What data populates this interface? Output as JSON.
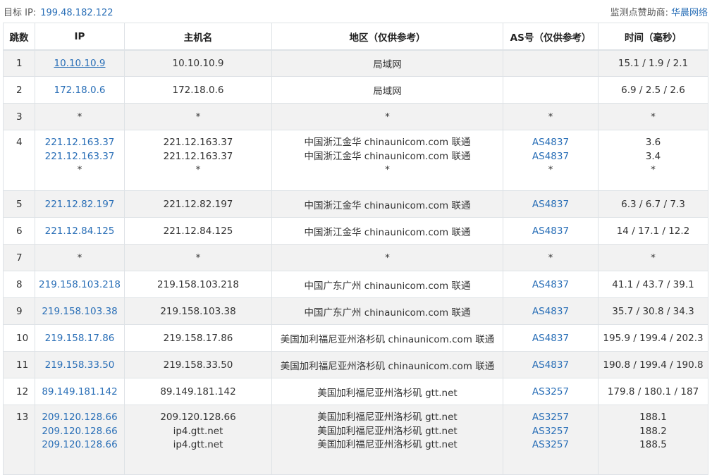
{
  "header": {
    "target_label": "目标 IP:",
    "target_ip": "199.48.182.122",
    "sponsor_label": "监测点赞助商:",
    "sponsor_name": "华晨网络"
  },
  "table": {
    "columns": [
      "跳数",
      "IP",
      "主机名",
      "地区（仅供参考）",
      "AS号（仅供参考）",
      "时间（毫秒）"
    ],
    "rows": [
      {
        "hop": "1",
        "ips": [
          "10.10.10.9"
        ],
        "hosts": [
          "10.10.10.9"
        ],
        "regions": [
          "局域网"
        ],
        "as": [
          ""
        ],
        "times": [
          "15.1 / 1.9 / 2.1"
        ]
      },
      {
        "hop": "2",
        "ips": [
          "172.18.0.6"
        ],
        "hosts": [
          "172.18.0.6"
        ],
        "regions": [
          "局域网"
        ],
        "as": [
          ""
        ],
        "times": [
          "6.9 / 2.5 / 2.6"
        ]
      },
      {
        "hop": "3",
        "ips": [
          "*"
        ],
        "hosts": [
          "*"
        ],
        "regions": [
          "*"
        ],
        "as": [
          "*"
        ],
        "times": [
          "*"
        ]
      },
      {
        "hop": "4",
        "ips": [
          "221.12.163.37",
          "221.12.163.37",
          "*"
        ],
        "hosts": [
          "221.12.163.37",
          "221.12.163.37",
          "*"
        ],
        "regions": [
          "中国浙江金华 chinaunicom.com 联通",
          "中国浙江金华 chinaunicom.com 联通",
          "*"
        ],
        "as": [
          "AS4837",
          "AS4837",
          "*"
        ],
        "times": [
          "3.6",
          "3.4",
          "*"
        ]
      },
      {
        "hop": "5",
        "ips": [
          "221.12.82.197"
        ],
        "hosts": [
          "221.12.82.197"
        ],
        "regions": [
          "中国浙江金华 chinaunicom.com 联通"
        ],
        "as": [
          "AS4837"
        ],
        "times": [
          "6.3 / 6.7 / 7.3"
        ]
      },
      {
        "hop": "6",
        "ips": [
          "221.12.84.125"
        ],
        "hosts": [
          "221.12.84.125"
        ],
        "regions": [
          "中国浙江金华 chinaunicom.com 联通"
        ],
        "as": [
          "AS4837"
        ],
        "times": [
          "14 / 17.1 / 12.2"
        ]
      },
      {
        "hop": "7",
        "ips": [
          "*"
        ],
        "hosts": [
          "*"
        ],
        "regions": [
          "*"
        ],
        "as": [
          "*"
        ],
        "times": [
          "*"
        ]
      },
      {
        "hop": "8",
        "ips": [
          "219.158.103.218"
        ],
        "hosts": [
          "219.158.103.218"
        ],
        "regions": [
          "中国广东广州 chinaunicom.com 联通"
        ],
        "as": [
          "AS4837"
        ],
        "times": [
          "41.1 / 43.7 / 39.1"
        ]
      },
      {
        "hop": "9",
        "ips": [
          "219.158.103.38"
        ],
        "hosts": [
          "219.158.103.38"
        ],
        "regions": [
          "中国广东广州 chinaunicom.com 联通"
        ],
        "as": [
          "AS4837"
        ],
        "times": [
          "35.7 / 30.8 / 34.3"
        ]
      },
      {
        "hop": "10",
        "ips": [
          "219.158.17.86"
        ],
        "hosts": [
          "219.158.17.86"
        ],
        "regions": [
          "美国加利福尼亚州洛杉矶 chinaunicom.com 联通"
        ],
        "as": [
          "AS4837"
        ],
        "times": [
          "195.9 / 199.4 / 202.3"
        ]
      },
      {
        "hop": "11",
        "ips": [
          "219.158.33.50"
        ],
        "hosts": [
          "219.158.33.50"
        ],
        "regions": [
          "美国加利福尼亚州洛杉矶 chinaunicom.com 联通"
        ],
        "as": [
          "AS4837"
        ],
        "times": [
          "190.8 / 199.4 / 190.8"
        ]
      },
      {
        "hop": "12",
        "ips": [
          "89.149.181.142"
        ],
        "hosts": [
          "89.149.181.142"
        ],
        "regions": [
          "美国加利福尼亚州洛杉矶 gtt.net"
        ],
        "as": [
          "AS3257"
        ],
        "times": [
          "179.8 / 180.1 / 187"
        ]
      },
      {
        "hop": "13",
        "ips": [
          "209.120.128.66",
          "209.120.128.66",
          "209.120.128.66"
        ],
        "hosts": [
          "209.120.128.66",
          "ip4.gtt.net",
          "ip4.gtt.net"
        ],
        "regions": [
          "美国加利福尼亚州洛杉矶 gtt.net",
          "美国加利福尼亚州洛杉矶 gtt.net",
          "美国加利福尼亚州洛杉矶 gtt.net"
        ],
        "as": [
          "AS3257",
          "AS3257",
          "AS3257"
        ],
        "times": [
          "188.1",
          "188.2",
          "188.5"
        ]
      }
    ]
  }
}
